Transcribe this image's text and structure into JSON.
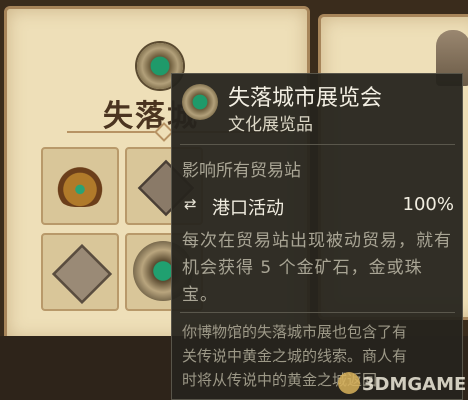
{
  "background": {
    "panel_title": "失落城"
  },
  "tooltip": {
    "title": "失落城市展览会",
    "subtitle": "文化展览品",
    "effect_header": "影响所有贸易站",
    "effect": {
      "icon": "swap-arrows-icon",
      "label": "港口活动",
      "value": "100%"
    },
    "description": "每次在贸易站出现被动贸易，就有机会获得 5 个金矿石，金或珠宝。",
    "lore": "你博物馆的失落城市展也包含了有\n关传说中黄金之城的线索。商人有\n时将从传说中的黄金之城返回"
  },
  "watermark": {
    "text": "3DMGAME"
  },
  "colors": {
    "parchment": "#eedfb8",
    "tooltip_bg": "#26241e",
    "text_primary": "#f3efe3",
    "text_secondary": "#a9a595"
  }
}
